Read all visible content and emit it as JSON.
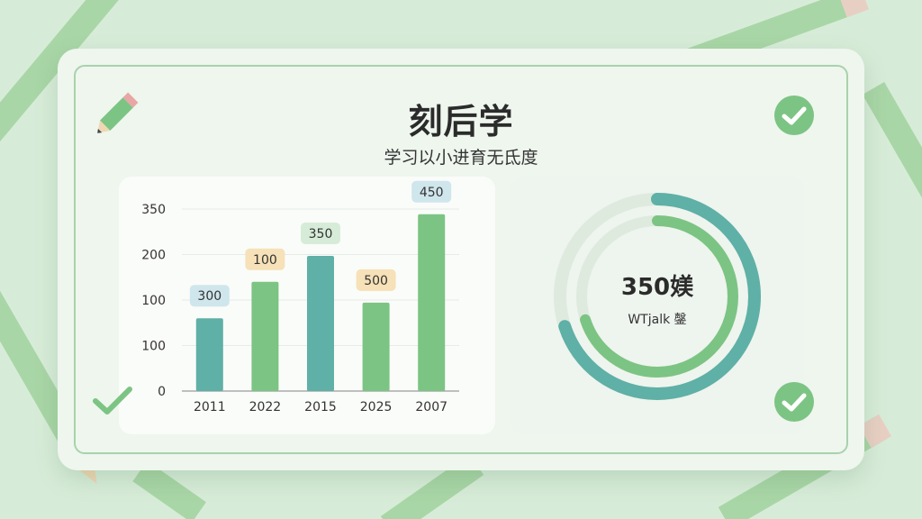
{
  "header": {
    "title": "刻后学",
    "subtitle": "学习以小进育无氐度"
  },
  "chart_data": [
    {
      "type": "bar",
      "categories": [
        "2011",
        "2022",
        "2015",
        "2025",
        "2007"
      ],
      "values": [
        140,
        210,
        260,
        170,
        340
      ],
      "data_labels": [
        "300",
        "100",
        "350",
        "500",
        "450"
      ],
      "y_tick_labels": [
        "0",
        "100",
        "100",
        "200",
        "350"
      ],
      "ylim": [
        0,
        350
      ],
      "grid": true,
      "colors": [
        "#5fb0a6",
        "#7cc483",
        "#5fb0a6",
        "#7cc483",
        "#7cc483"
      ],
      "label_colors": [
        "#cfe6ec",
        "#f6e1b8",
        "#d7ecd8",
        "#f6e1b8",
        "#cfe6ec"
      ]
    },
    {
      "type": "pie",
      "center_value": "350媄",
      "center_label": "WTjalk 鏧",
      "rings": [
        {
          "name": "outer",
          "value": 0.7,
          "color": "#5fb0a6"
        },
        {
          "name": "inner",
          "value": 0.7,
          "color": "#7cc483"
        }
      ],
      "track_color": "#dfeadf"
    }
  ],
  "icons": {
    "check_top_right": "check-circle-icon",
    "check_bottom_right": "check-circle-icon",
    "check_bottom_left": "checkmark-icon",
    "pencil": "pencil-icon"
  },
  "colors": {
    "accent_teal": "#5fb0a6",
    "accent_green": "#7cc483",
    "background": "#d7ecd8"
  }
}
